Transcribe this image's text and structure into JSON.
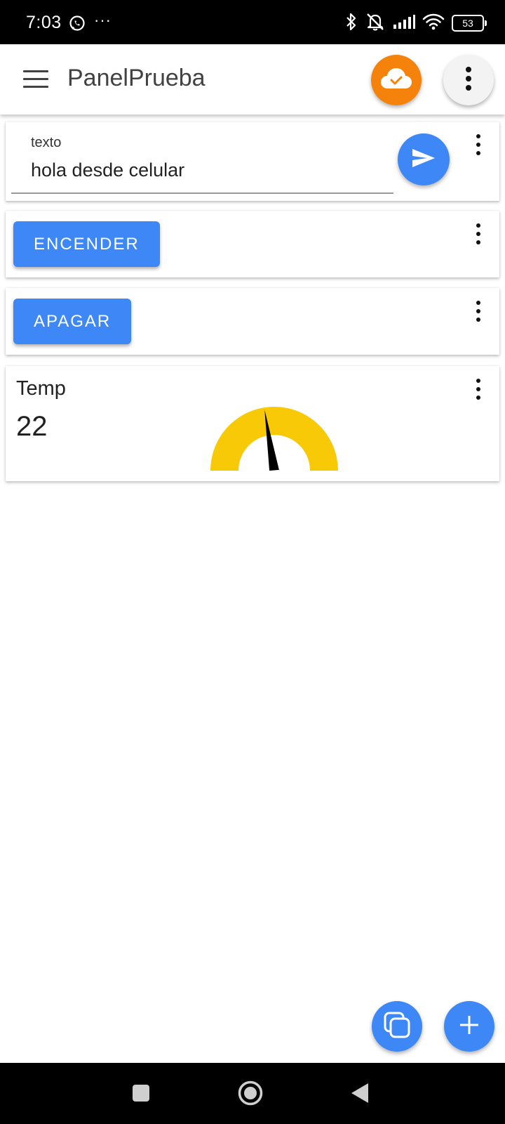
{
  "status_bar": {
    "time": "7:03",
    "dots": "···",
    "battery_level": "53",
    "icons": [
      "whatsapp-icon",
      "bluetooth-icon",
      "mute-icon",
      "signal-icon",
      "wifi-icon",
      "battery-icon"
    ]
  },
  "app_bar": {
    "title": "PanelPrueba",
    "icons": [
      "menu-icon",
      "cloud-check-icon",
      "more-vert-icon"
    ],
    "cloud_color": "#f5820b"
  },
  "widgets": {
    "text_input": {
      "label": "texto",
      "value": "hola desde celular",
      "send_icon": "send-icon"
    },
    "button_on": {
      "label": "ENCENDER"
    },
    "button_off": {
      "label": "APAGAR"
    },
    "gauge": {
      "label": "Temp",
      "value": "22",
      "level": 0.45,
      "gauge_color": "#f8c906"
    }
  },
  "fabs": [
    "copy-icon",
    "add-icon"
  ],
  "nav_bar": [
    "recents-icon",
    "home-icon",
    "back-icon"
  ],
  "colors": {
    "accent": "#3d87f6",
    "cloud": "#f5820b",
    "gauge": "#f8c906"
  }
}
